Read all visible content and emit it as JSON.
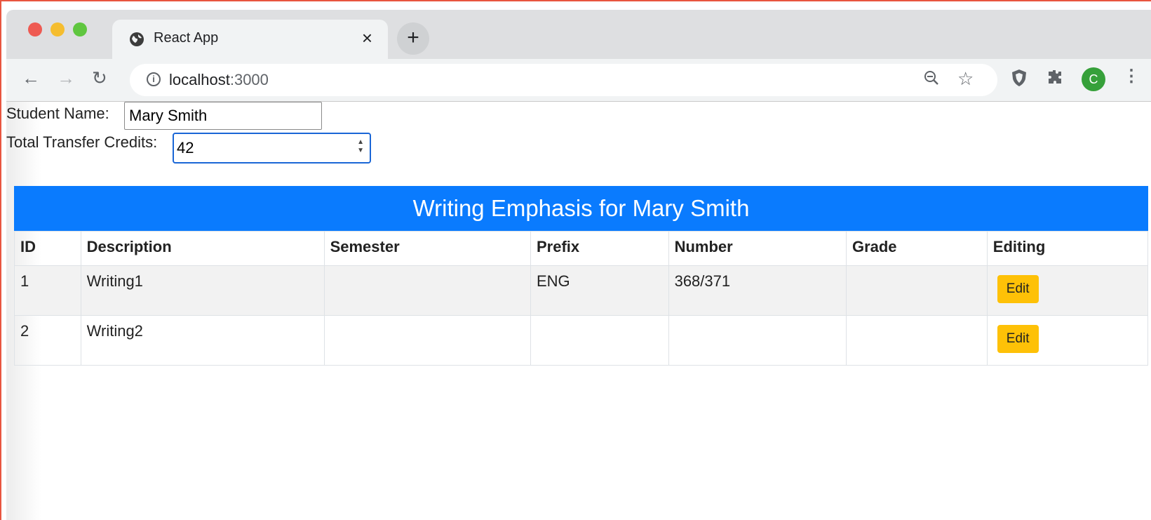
{
  "browser": {
    "tab_title": "React App",
    "tab_close": "×",
    "new_tab": "+",
    "url_host": "localhost",
    "url_port": ":3000",
    "avatar_letter": "C"
  },
  "form": {
    "student_name_label": "Student Name:",
    "student_name_value": "Mary Smith",
    "credits_label": "Total Transfer Credits:",
    "credits_value": "42"
  },
  "table": {
    "title": "Writing Emphasis for Mary Smith",
    "headers": {
      "id": "ID",
      "description": "Description",
      "semester": "Semester",
      "prefix": "Prefix",
      "number": "Number",
      "grade": "Grade",
      "editing": "Editing"
    },
    "rows": [
      {
        "id": "1",
        "description": "Writing1",
        "semester": "",
        "prefix": "ENG",
        "number": "368/371",
        "grade": "",
        "edit_label": "Edit"
      },
      {
        "id": "2",
        "description": "Writing2",
        "semester": "",
        "prefix": "",
        "number": "",
        "grade": "",
        "edit_label": "Edit"
      }
    ]
  },
  "colors": {
    "header_blue": "#0a7bfe",
    "edit_yellow": "#fec107",
    "avatar_green": "#36a03a"
  }
}
